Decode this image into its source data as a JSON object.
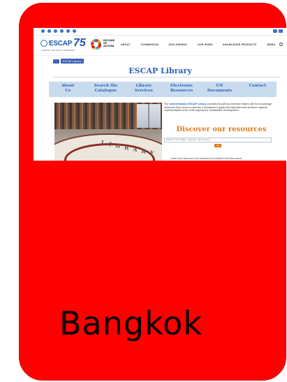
{
  "page": {
    "card_color": "#ff0000",
    "caption": "Bangkok"
  },
  "screenshot": {
    "topbar": {
      "social_icons": [
        "twitter-icon",
        "facebook-icon",
        "youtube-icon",
        "instagram-icon",
        "flickr-icon",
        "linkedin-icon"
      ],
      "language_icons": [
        "language-icon",
        "language-icon"
      ]
    },
    "nav": {
      "logo_text": "ESCAP",
      "logo_number": "75",
      "logo_tagline": "ECONOMIC AND SOCIAL COMMISSION",
      "sdg_text": "DECADE OF ACTION",
      "links": [
        "ABOUT",
        "COMMISSION",
        "2030 AGENDA",
        "OUR WORK",
        "KNOWLEDGE PRODUCTS",
        "NEWS"
      ]
    },
    "breadcrumb": "ESCAP Library",
    "title": "ESCAP Library",
    "tabs": [
      {
        "label_1": "About",
        "label_2": "Us"
      },
      {
        "label_1": "Search the",
        "label_2": "Catalogue"
      },
      {
        "label_1": "Library",
        "label_2": "Services"
      },
      {
        "label_1": "Electronic",
        "label_2": "Resources"
      },
      {
        "label_1": "UN",
        "label_2": "Documents"
      },
      {
        "label_1": "Contact",
        "label_2": ""
      }
    ],
    "photo_word": "LIBRARY",
    "intro_prefix": "The ",
    "intro_highlight": "United Nations ESCAP Library",
    "intro_rest": " provides its staff and Member States with the knowledge resources they need to meet the Commission's goals and objectives and advance regional implementation of the 2030 Agenda for Sustainable Development.",
    "discover_heading": "Discover our resources",
    "search_placeholder": "Search for books, articles, and more...",
    "search_button": "Go",
    "learn_more": "Learn more about our core services and policies in the tabs above."
  }
}
